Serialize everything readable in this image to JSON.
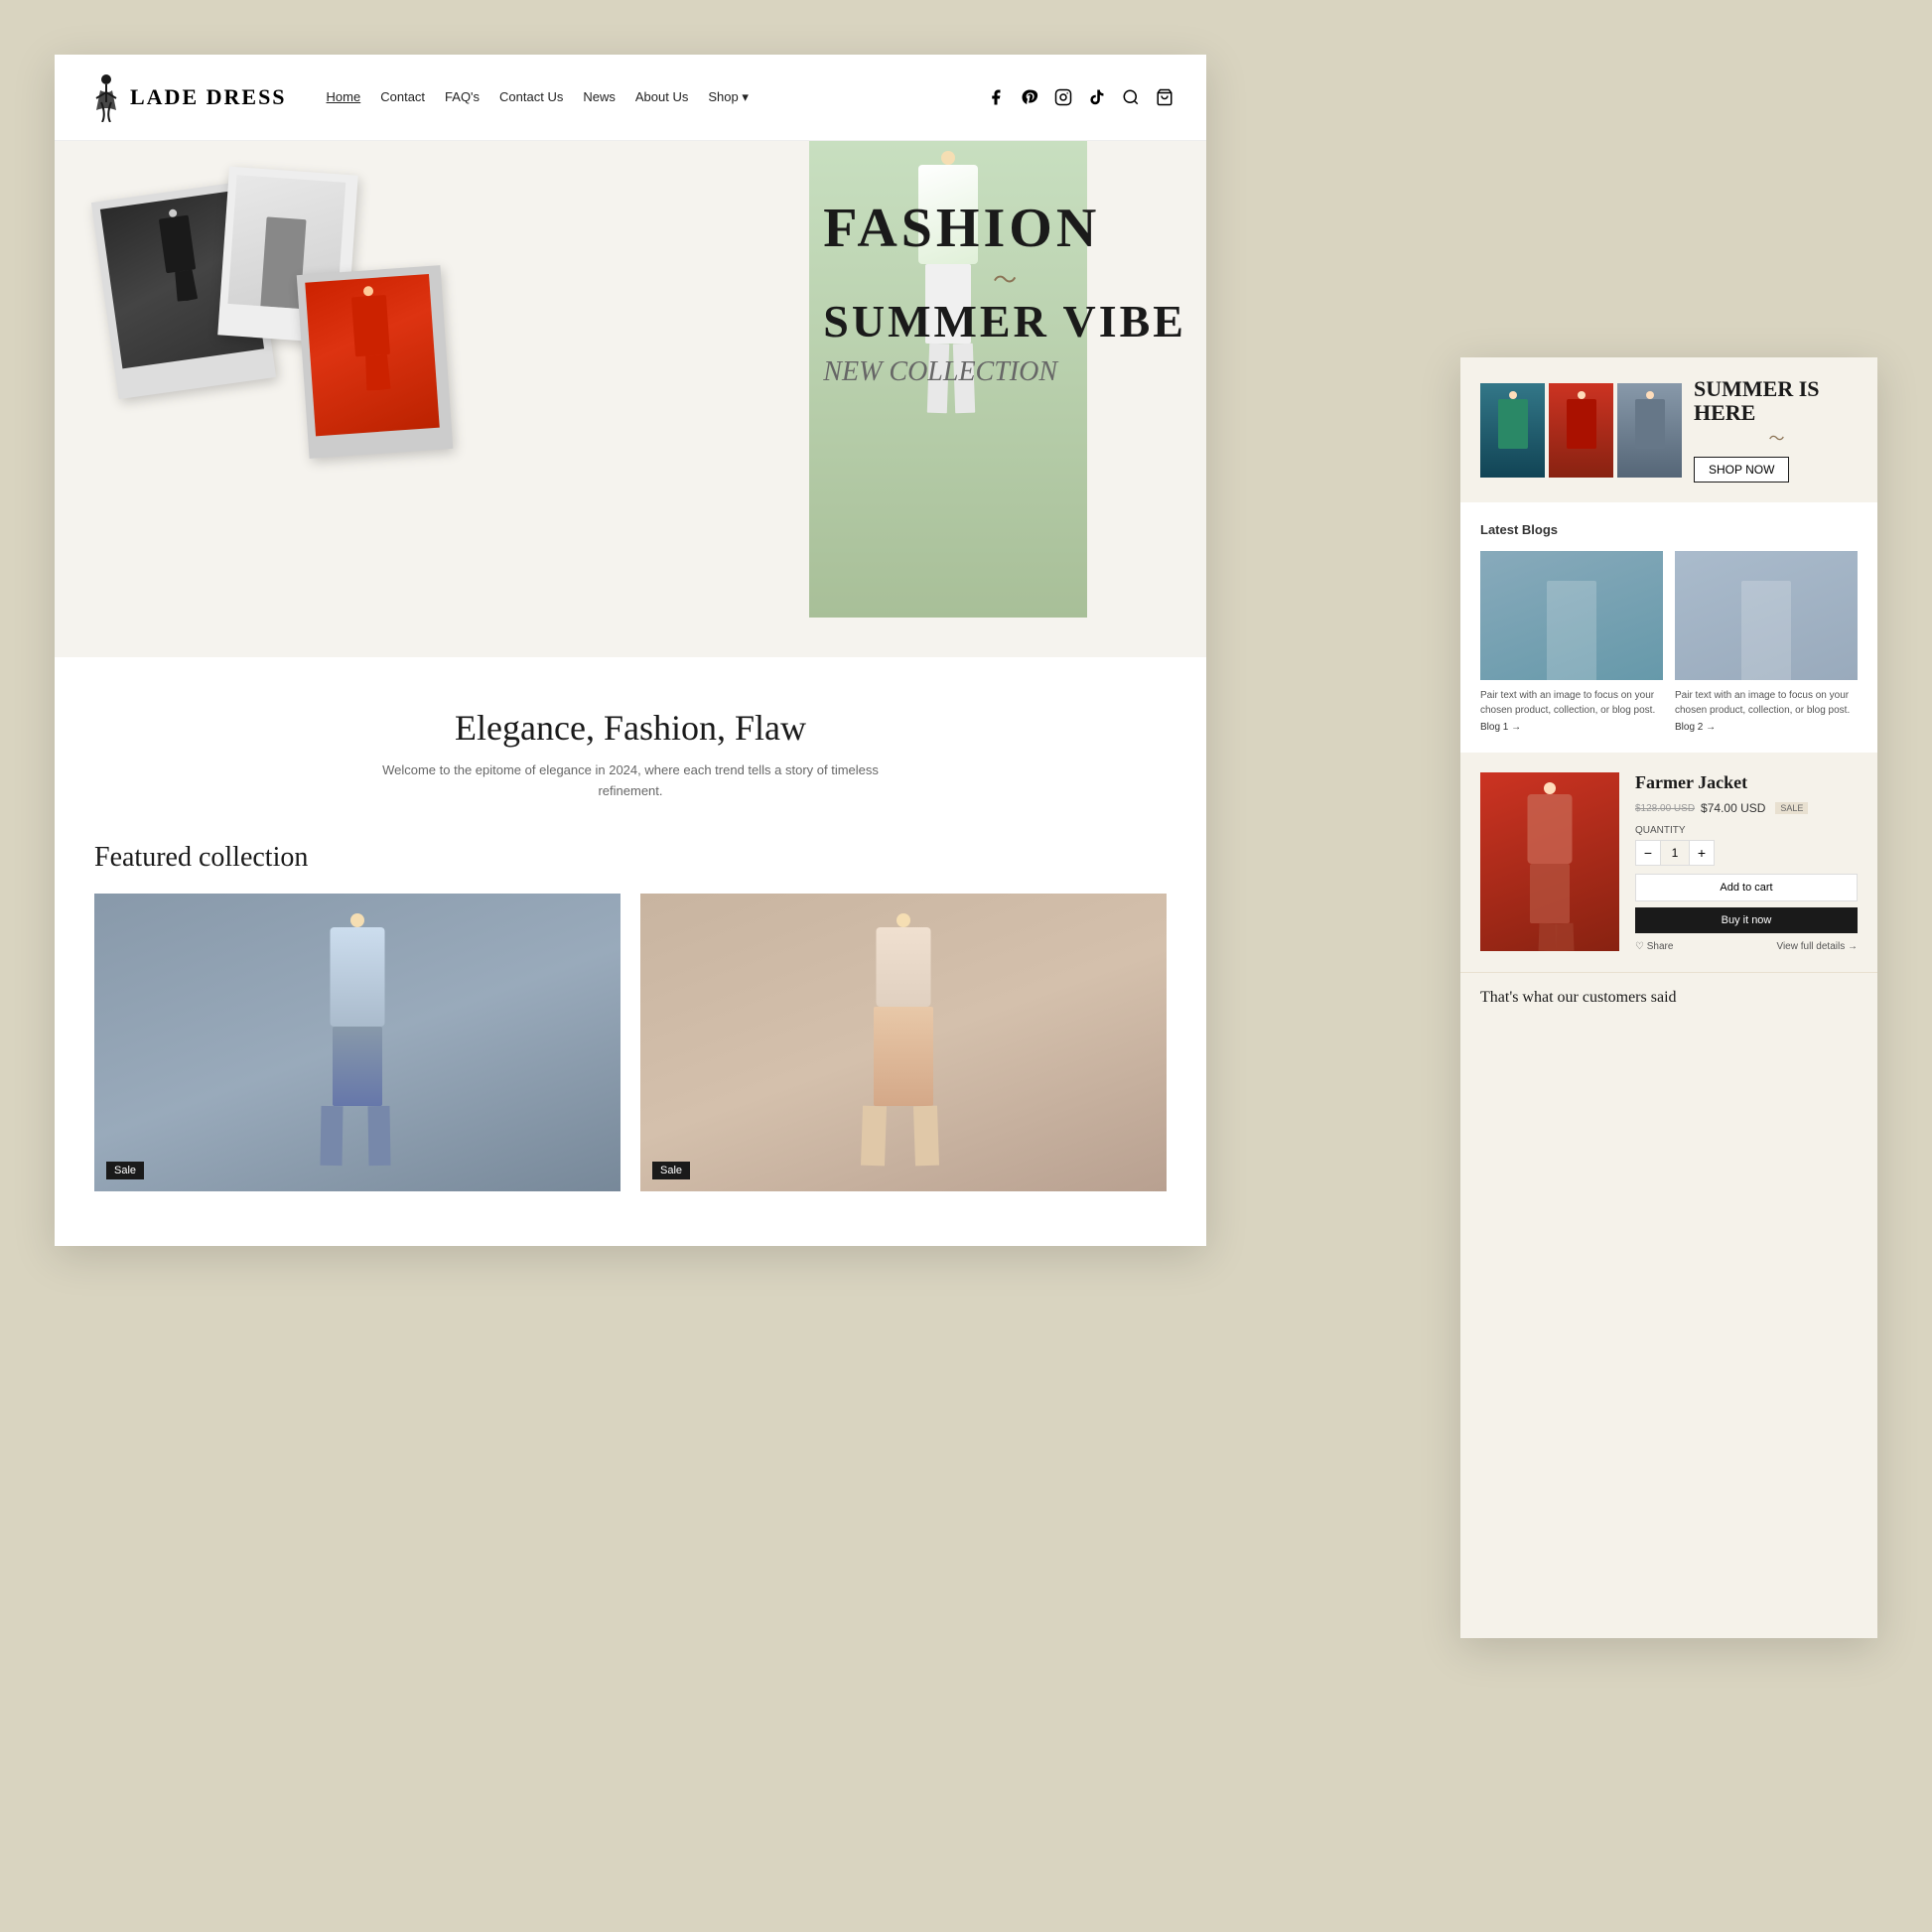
{
  "site": {
    "logo_text": "LADE DRESS",
    "bg_color": "#d9d4c0"
  },
  "navbar": {
    "links": [
      {
        "label": "Home",
        "active": true
      },
      {
        "label": "Contact",
        "active": false
      },
      {
        "label": "FAQ's",
        "active": false
      },
      {
        "label": "Contact Us",
        "active": false
      },
      {
        "label": "News",
        "active": false
      },
      {
        "label": "About Us",
        "active": false
      },
      {
        "label": "Shop",
        "active": false,
        "dropdown": true
      }
    ]
  },
  "hero": {
    "title1": "FASHION",
    "title2": "SUMMER VIBE",
    "subtitle": "NEW COLLECTION"
  },
  "elegance": {
    "title": "Elegance, Fashion, Flaw",
    "description": "Welcome to the epitome of elegance in 2024, where each trend tells a story of timeless refinement."
  },
  "featured": {
    "title": "Featured collection",
    "items": [
      {
        "sale": true,
        "label": "Sale"
      },
      {
        "sale": true,
        "label": "Sale"
      }
    ]
  },
  "summer": {
    "title": "SUMMER IS HERE",
    "cta": "SHOP NOW"
  },
  "blogs": {
    "section_title": "Latest Blogs",
    "items": [
      {
        "desc": "Pair text with an image to focus on your chosen product, collection, or blog post.",
        "link": "Blog 1 →"
      },
      {
        "desc": "Pair text with an image to focus on your chosen product, collection, or blog post.",
        "link": "Blog 2 →"
      }
    ]
  },
  "product": {
    "title": "Farmer Jacket",
    "price_old": "$128.00 USD",
    "price_new": "$74.00 USD",
    "badge": "SALE",
    "quantity_label": "QUANTITY",
    "qty": "1",
    "add_to_cart": "Add to cart",
    "buy_now": "Buy it now",
    "share": "♡ Share",
    "view_details": "View full details →"
  },
  "customers": {
    "title": "That's what our customers said"
  },
  "icons": {
    "facebook": "f",
    "pinterest": "p",
    "instagram": "◻",
    "tiktok": "♪",
    "search": "🔍",
    "cart": "🛒",
    "shop_dropdown": "▾"
  }
}
